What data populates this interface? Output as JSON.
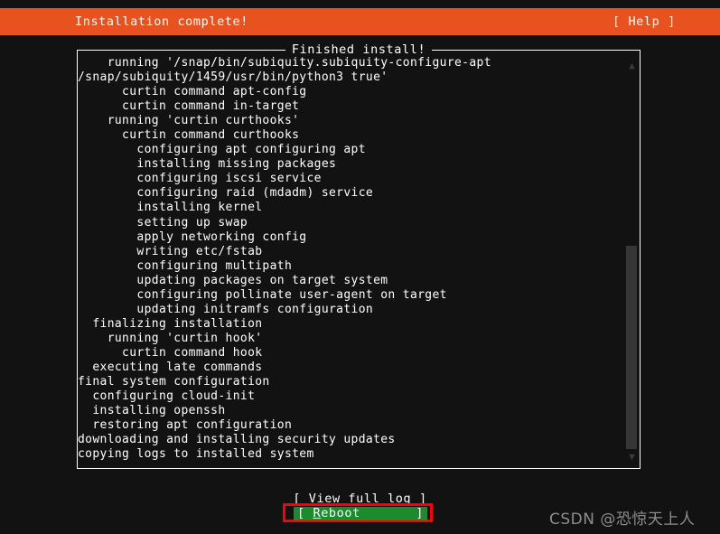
{
  "header": {
    "title": "Installation complete!",
    "help_label": "[ Help ]",
    "bar_color": "#e8521f"
  },
  "log_panel": {
    "frame_title": "Finished install!",
    "lines": [
      "    running '/snap/bin/subiquity.subiquity-configure-apt",
      "/snap/subiquity/1459/usr/bin/python3 true'",
      "      curtin command apt-config",
      "      curtin command in-target",
      "    running 'curtin curthooks'",
      "      curtin command curthooks",
      "        configuring apt configuring apt",
      "        installing missing packages",
      "        configuring iscsi service",
      "        configuring raid (mdadm) service",
      "        installing kernel",
      "        setting up swap",
      "        apply networking config",
      "        writing etc/fstab",
      "        configuring multipath",
      "        updating packages on target system",
      "        configuring pollinate user-agent on target",
      "        updating initramfs configuration",
      "  finalizing installation",
      "    running 'curtin hook'",
      "      curtin command hook",
      "  executing late commands",
      "final system configuration",
      "  configuring cloud-init",
      "  installing openssh",
      "  restoring apt configuration",
      "downloading and installing security updates",
      "copying logs to installed system"
    ],
    "scrollbar": {
      "up_arrow": "▲",
      "down_arrow": "▼"
    }
  },
  "footer": {
    "view_full_log_label": "[ View full log ]",
    "reboot_bracket_open": "[",
    "reboot_label_prefix": "R",
    "reboot_label_rest": "eboot",
    "reboot_bracket_close": "]",
    "reboot_highlight_color": "#1d8a2c",
    "annotation_box_color": "#ff0000"
  },
  "watermark": {
    "text": "CSDN @恐惊天上人"
  }
}
